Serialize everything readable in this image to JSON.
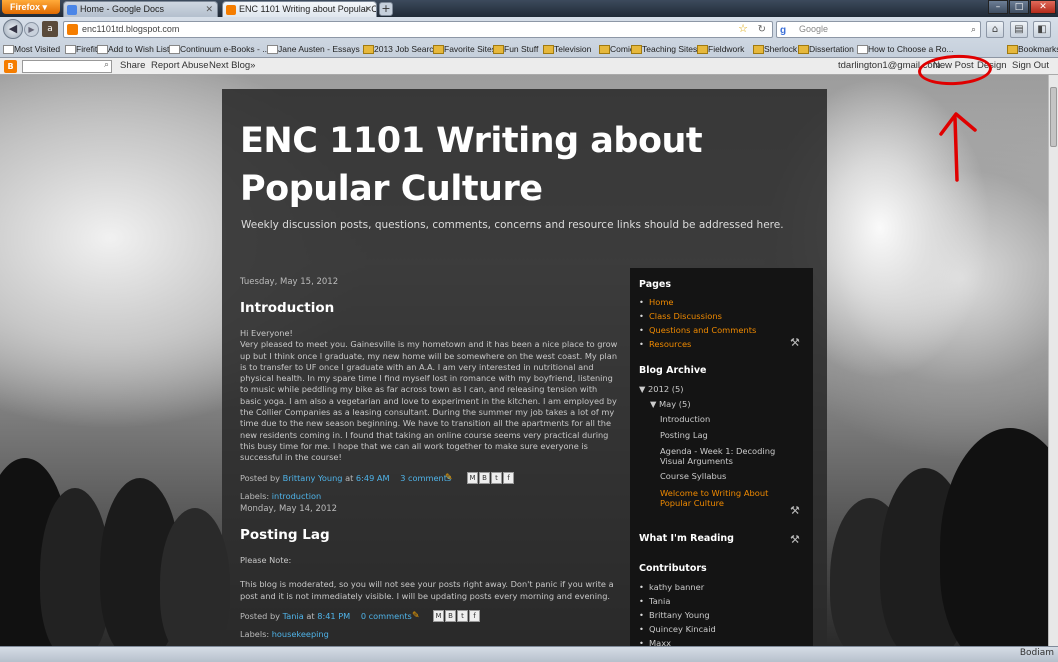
{
  "browser": {
    "app_button": "Firefox",
    "tabs": [
      {
        "label": "Home - Google Docs",
        "active": false
      },
      {
        "label": "ENC 1101 Writing about Popular Cult...",
        "active": true
      }
    ],
    "new_tab": "+",
    "url": "enc1101td.blogspot.com",
    "search_placeholder": "Google",
    "bookmarks": [
      "Most Visited",
      "Firefit",
      "Add to Wish List",
      "Continuum e-Books - ...",
      "Jane Austen - Essays ...",
      "2013 Job Search",
      "Favorite Sites",
      "Fun Stuff",
      "Television",
      "Comic",
      "Teaching Sites",
      "Fieldwork",
      "Sherlock",
      "Dissertation",
      "How to Choose a Ro..."
    ],
    "bookmarks_right": "Bookmarks"
  },
  "blogger_bar": {
    "share": "Share",
    "report": "Report Abuse",
    "next": "Next Blog»",
    "email": "tdarlington1@gmail.com",
    "new_post": "New Post",
    "design": "Design",
    "sign_out": "Sign Out"
  },
  "blog": {
    "title": "ENC 1101 Writing about Popular Culture",
    "description": "Weekly discussion posts, questions, comments, concerns and resource links should be addressed here."
  },
  "posts": [
    {
      "date": "Tuesday, May 15, 2012",
      "title": "Introduction",
      "body": "Hi Everyone!\nVery pleased to meet you. Gainesville is my hometown and it has been a nice place to grow up but I think once I graduate, my new home will be somewhere on the west coast. My plan is to transfer to UF once I graduate with an A.A. I am very interested in nutritional and physical health. In my spare time I find myself lost in romance with my boyfriend, listening to music while peddling my bike as far across town as I can, and releasing tension with basic yoga.  I am also a vegetarian and love to experiment in the kitchen.  I am  employed by the Collier Companies as a leasing consultant. During the summer my job takes a lot of my time due to the new season beginning. We have to transition all the apartments for all the new residents coming in. I found that taking an online course seems very practical during this busy time for me. I hope that we can all work together to make sure everyone is successful in the course!",
      "posted_by_label": "Posted by",
      "author": "Brittany Young",
      "at_label": "at",
      "time": "6:49 AM",
      "comments": "3 comments",
      "labels_label": "Labels:",
      "label": "introduction"
    },
    {
      "date": "Monday, May 14, 2012",
      "title": "Posting Lag",
      "body_note": "Please Note:",
      "body": "This blog is moderated, so you will not see your posts right away.  Don't panic if you write a post and it is not immediately visible.  I will be updating posts every morning and evening.",
      "posted_by_label": "Posted by",
      "author": "Tania",
      "at_label": "at",
      "time": "8:41 PM",
      "comments": "0 comments",
      "labels_label": "Labels:",
      "label": "housekeeping"
    }
  ],
  "sidebar": {
    "pages_heading": "Pages",
    "pages": [
      "Home",
      "Class Discussions",
      "Questions and Comments",
      "Resources"
    ],
    "archive_heading": "Blog Archive",
    "archive_year": "▼ 2012 (5)",
    "archive_month": "▼ May (5)",
    "archive_posts": [
      "Introduction",
      "Posting Lag",
      "Agenda - Week 1: Decoding Visual Arguments",
      "Course Syllabus",
      "Welcome to Writing About Popular Culture"
    ],
    "reading_heading": "What I'm Reading",
    "contributors_heading": "Contributors",
    "contributors": [
      "kathy banner",
      "Tania",
      "Brittany Young",
      "Quincey Kincaid",
      "Maxx"
    ]
  },
  "annotation_color": "#e00000",
  "status_right": "Bodiam"
}
